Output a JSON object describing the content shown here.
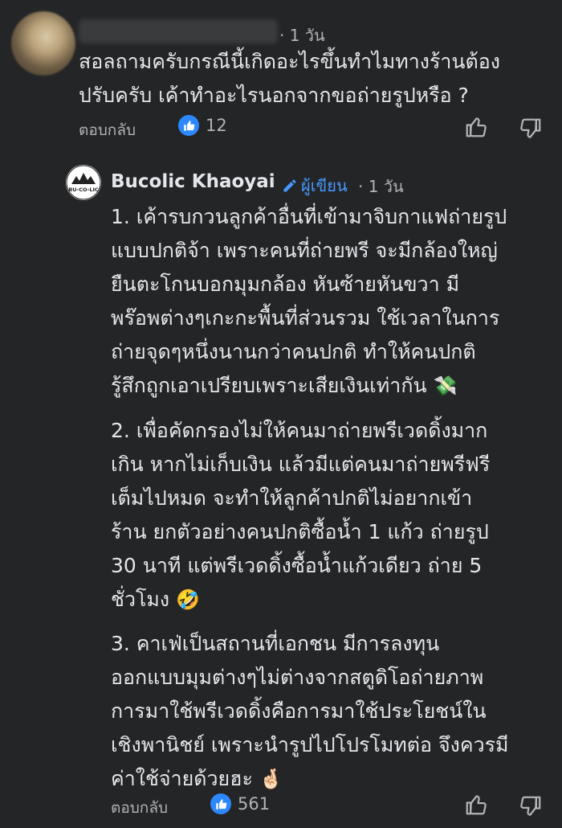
{
  "comment1": {
    "time": "· 1 วัน",
    "text": "สอลถามครับกรณีนี้เกิดอะไรขึ้นทำไมทางร้านต้อง\nปรับครับ เค้าทำอะไรนอกจากขอถ่ายรูปหรือ ?",
    "reply_label": "ตอบกลับ",
    "like_count": "12",
    "like_icon": "thumbs-up-icon"
  },
  "comment2": {
    "author": "Bucolic Khaoyai",
    "author_sep": "·",
    "badge_label": "ผู้เขียน",
    "time": "· 1 วัน",
    "avatar_text": "BU-CO-LIC",
    "p1": "1. เค้ารบกวนลูกค้าอื่นที่เข้ามาจิบกาแฟถ่ายรูป\nแบบปกติจ้า เพราะคนที่ถ่ายพรี จะมีกล้องใหญ่\nยืนตะโกนบอกมุมกล้อง หันซ้ายหันขวา มี\nพร๊อพต่างๆเกะกะพื้นที่ส่วนรวม ใช้เวลาในการ\nถ่ายจุดๆหนึ่งนานกว่าคนปกติ ทำให้คนปกติ\nรู้สึกถูกเอาเปรียบเพราะเสียเงินเท่ากัน",
    "p1_emoji": "💸",
    "p2": "2. เพื่อคัดกรองไม่ให้คนมาถ่ายพรีเวดดิ้งมาก\nเกิน หากไม่เก็บเงิน แล้วมีแต่คนมาถ่ายพรีฟรี\nเต็มไปหมด จะทำให้ลูกค้าปกติไม่อยากเข้า\nร้าน ยกตัวอย่างคนปกติซื้อน้ำ 1 แก้ว ถ่ายรูป\n30 นาที แต่พรีเวดดิ้งซื้อน้ำแก้วเดียว ถ่าย 5\nชั่วโมง",
    "p2_emoji": "🤣",
    "p3": "3. คาเฟ่เป็นสถานที่เอกชน มีการลงทุน\nออกแบบมุมต่างๆไม่ต่างจากสตูดิโอถ่ายภาพ\nการมาใช้พรีเวดดิ้งคือการมาใช้ประโยชน์ใน\nเชิงพานิชย์ เพราะนำรูปไปโปรโมทต่อ จึงควรมี\nค่าใช้จ่ายด้วยฮะ",
    "p3_emoji": "🤞🏻",
    "reply_label": "ตอบกลับ",
    "like_count": "561"
  },
  "colors": {
    "background": "#242526",
    "text": "#e4e6eb",
    "muted": "#b0b3b8",
    "accent": "#2d88ff",
    "author_badge": "#4599ff"
  }
}
